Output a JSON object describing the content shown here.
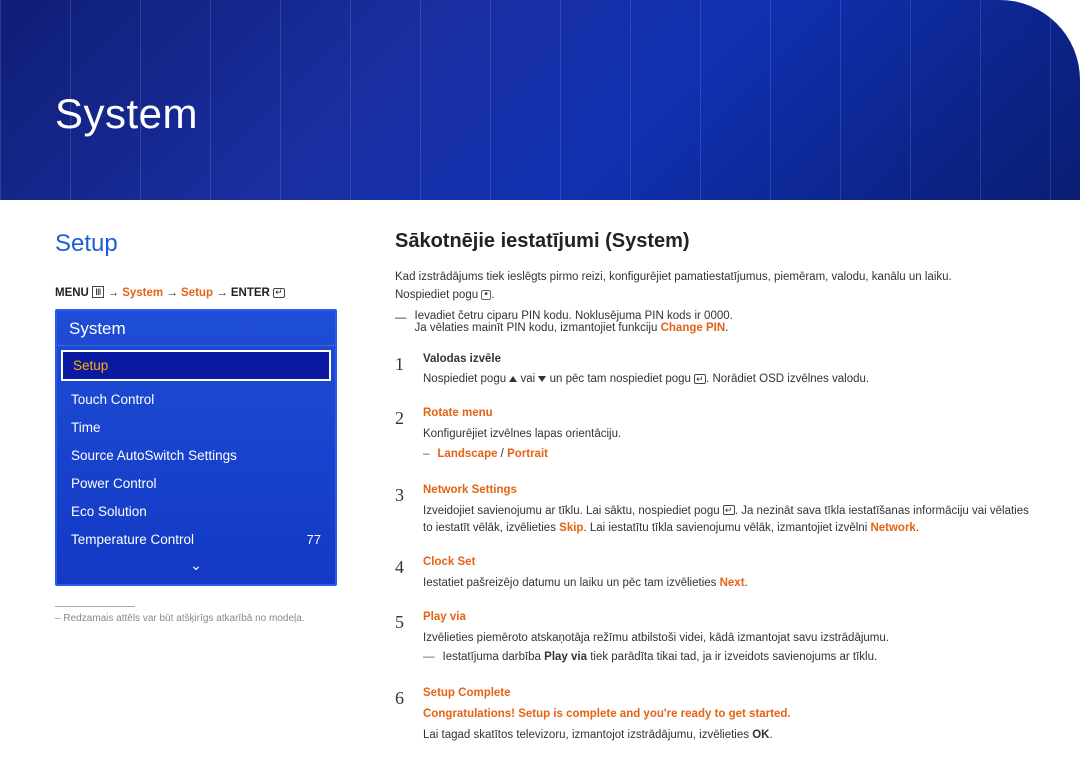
{
  "banner": {
    "title": "System"
  },
  "left": {
    "section_title": "Setup",
    "breadcrumb": {
      "menu": "MENU",
      "arrow": "→",
      "p1": "System",
      "p2": "Setup",
      "enter": "ENTER"
    },
    "menu": {
      "header": "System",
      "items": [
        {
          "label": "Setup",
          "value": "",
          "selected": true
        },
        {
          "label": "Touch Control",
          "value": ""
        },
        {
          "label": "Time",
          "value": ""
        },
        {
          "label": "Source AutoSwitch Settings",
          "value": ""
        },
        {
          "label": "Power Control",
          "value": ""
        },
        {
          "label": "Eco Solution",
          "value": ""
        },
        {
          "label": "Temperature Control",
          "value": "77"
        }
      ],
      "chevron": "⌄"
    },
    "footnote_marker": "–",
    "footnote": "Redzamais attēls var būt atšķirīgs atkarībā no modeļa."
  },
  "right": {
    "heading": "Sākotnējie iestatījumi (System)",
    "intro": "Kad izstrādājums tiek ieslēgts pirmo reizi, konfigurējiet pamatiestatījumus, piemēram, valodu, kanālu un laiku.",
    "press_label": "Nospiediet pogu",
    "press_suffix": ".",
    "dash1": {
      "marker": "―",
      "text": "Ievadiet četru ciparu PIN kodu. Noklusējuma PIN kods ir 0000.",
      "sub": "Ja vēlaties mainīt PIN kodu, izmantojiet funkciju ",
      "sub_strong": "Change PIN",
      "sub_end": "."
    },
    "steps": [
      {
        "num": "1",
        "title": "Valodas izvēle",
        "title_orange": false,
        "body_prefix": "Nospiediet pogu ",
        "body_mid": " vai ",
        "body_after": " un pēc tam nospiediet pogu ",
        "body_tail": ". Norādiet OSD izvēlnes valodu."
      },
      {
        "num": "2",
        "title": "Rotate menu",
        "title_orange": true,
        "body": "Konfigurējiet izvēlnes lapas orientāciju.",
        "dash": {
          "marker": "–",
          "text_a": "Landscape",
          "sep": " / ",
          "text_b": "Portrait"
        }
      },
      {
        "num": "3",
        "title": "Network Settings",
        "title_orange": true,
        "body_prefix": "Izveidojiet savienojumu ar tīklu. Lai sāktu, nospiediet pogu ",
        "body_mid2": ". Ja nezināt sava tīkla iestatīšanas informāciju vai vēlaties to iestatīt vēlāk, izvēlieties ",
        "skip": "Skip",
        "body_mid3": ". Lai iestatītu tīkla savienojumu vēlāk, izmantojiet izvēlni ",
        "network": "Network",
        "body_end": "."
      },
      {
        "num": "4",
        "title": "Clock Set",
        "title_orange": true,
        "body_a": "Iestatiet pašreizējo datumu un laiku un pēc tam izvēlieties ",
        "next": "Next",
        "body_b": "."
      },
      {
        "num": "5",
        "title": "Play via",
        "title_orange": true,
        "body": "Izvēlieties piemēroto atskaņotāja režīmu atbilstoši videi, kādā izmantojat savu izstrādājumu.",
        "dash": {
          "marker": "―",
          "pre": "Iestatījuma darbība ",
          "strong": "Play via",
          "post": " tiek parādīta tikai tad, ja ir izveidots savienojums ar tīklu."
        }
      },
      {
        "num": "6",
        "title": "Setup Complete",
        "title_orange": true,
        "body_strong": "Congratulations! Setup is complete and you're ready to get started.",
        "body_a": "Lai tagad skatītos televizoru, izmantojot izstrādājumu, izvēlieties ",
        "ok": "OK",
        "body_b": "."
      }
    ]
  }
}
